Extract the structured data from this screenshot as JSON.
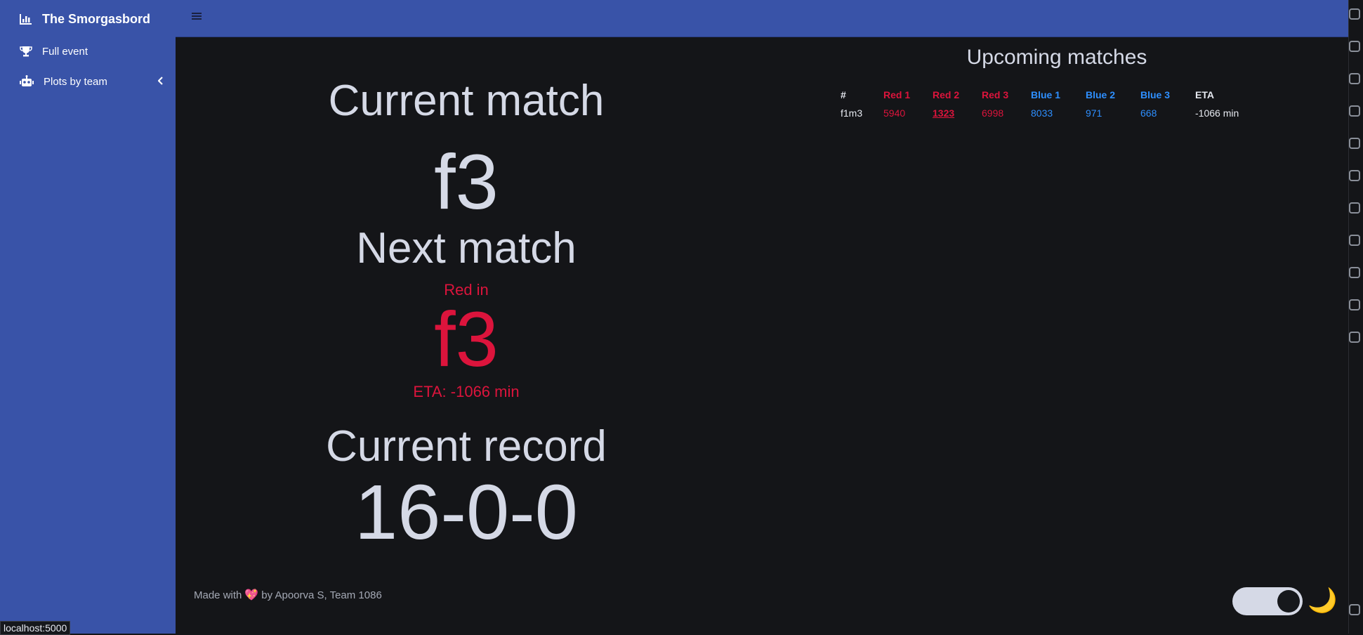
{
  "sidebar": {
    "brand": "The Smorgasbord",
    "brand_icon": "bar-chart-icon",
    "items": [
      {
        "label": "Full event",
        "icon": "trophy-icon"
      },
      {
        "label": "Plots by team",
        "icon": "robot-icon",
        "chevron": "chevron-left-icon"
      }
    ]
  },
  "topbar": {
    "menu_icon": "hamburger-icon"
  },
  "current_match": {
    "heading": "Current match",
    "value": "f3"
  },
  "next_match": {
    "heading": "Next match",
    "alliance_text": "Red in",
    "value": "f3",
    "eta": "ETA: -1066 min"
  },
  "current_record": {
    "heading": "Current record",
    "value": "16-0-0"
  },
  "upcoming": {
    "title": "Upcoming matches",
    "headers": [
      "#",
      "Red 1",
      "Red 2",
      "Red 3",
      "Blue 1",
      "Blue 2",
      "Blue 3",
      "ETA"
    ],
    "rows": [
      [
        "f1m3",
        "5940",
        "1323",
        "6998",
        "8033",
        "971",
        "668",
        "-1066 min"
      ]
    ]
  },
  "footer": {
    "prefix": "Made with",
    "heart": "💖",
    "suffix": "by Apoorva S, Team 1086"
  },
  "theme": {
    "moon": "🌙"
  },
  "status_url": "localhost:5000",
  "colors": {
    "sidebar": "#3953a8",
    "background": "#141518",
    "red": "#dc143c",
    "blue": "#2e8fff"
  }
}
